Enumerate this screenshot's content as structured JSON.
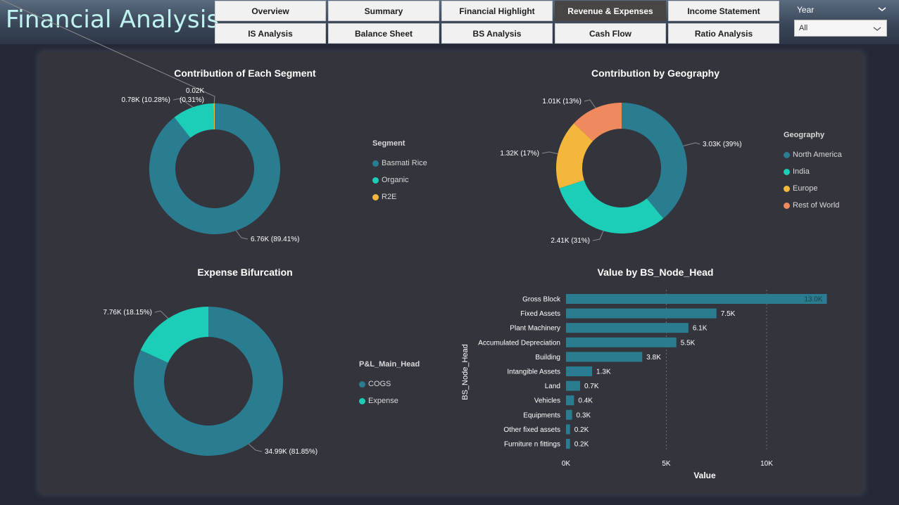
{
  "header": {
    "title": "Financial Analysis",
    "nav": [
      {
        "label": "Overview",
        "active": false
      },
      {
        "label": "Summary",
        "active": false
      },
      {
        "label": "Financial Highlight",
        "active": false
      },
      {
        "label": "Revenue & Expenses",
        "active": true
      },
      {
        "label": "Income Statement",
        "active": false
      },
      {
        "label": "IS Analysis",
        "active": false
      },
      {
        "label": "Balance Sheet",
        "active": false
      },
      {
        "label": "BS Analysis",
        "active": false
      },
      {
        "label": "Cash Flow",
        "active": false
      },
      {
        "label": "Ratio Analysis",
        "active": false
      }
    ],
    "year_filter": {
      "label": "Year",
      "value": "All",
      "icon": "chevron-down-icon"
    }
  },
  "colors": {
    "teal_dark": "#2a7d90",
    "teal_light": "#1ccdb7",
    "yellow": "#f5b73b",
    "orange": "#ee8a5e"
  },
  "chart_data": [
    {
      "type": "pie",
      "donut": true,
      "title": "Contribution of Each Segment",
      "legend_title": "Segment",
      "legend_position": "right",
      "slices": [
        {
          "name": "Basmati Rice",
          "value": 6.76,
          "label": "6.76K (89.41%)",
          "color": "#2a7d90"
        },
        {
          "name": "Organic",
          "value": 0.78,
          "label": "0.78K (10.28%)",
          "color": "#1ccdb7"
        },
        {
          "name": "R2E",
          "value": 0.02,
          "label": "0.02K (0.31%)",
          "color": "#f5b73b"
        }
      ]
    },
    {
      "type": "pie",
      "donut": true,
      "title": "Contribution by Geography",
      "legend_title": "Geography",
      "legend_position": "right",
      "slices": [
        {
          "name": "North America",
          "value": 3.03,
          "label": "3.03K (39%)",
          "color": "#2a7d90"
        },
        {
          "name": "India",
          "value": 2.41,
          "label": "2.41K (31%)",
          "color": "#1ccdb7"
        },
        {
          "name": "Europe",
          "value": 1.32,
          "label": "1.32K (17%)",
          "color": "#f5b73b"
        },
        {
          "name": "Rest of World",
          "value": 1.01,
          "label": "1.01K (13%)",
          "color": "#ee8a5e"
        }
      ]
    },
    {
      "type": "pie",
      "donut": true,
      "title": "Expense Bifurcation",
      "legend_title": "P&L_Main_Head",
      "legend_position": "right",
      "slices": [
        {
          "name": "COGS",
          "value": 34.99,
          "label": "34.99K (81.85%)",
          "color": "#2a7d90"
        },
        {
          "name": "Expense",
          "value": 7.76,
          "label": "7.76K (18.15%)",
          "color": "#1ccdb7"
        }
      ]
    },
    {
      "type": "bar",
      "orientation": "horizontal",
      "title": "Value by BS_Node_Head",
      "xlabel": "Value",
      "ylabel": "BS_Node_Head",
      "xlim": [
        0,
        13000
      ],
      "xticks": [
        {
          "value": 0,
          "label": "0K"
        },
        {
          "value": 5000,
          "label": "5K"
        },
        {
          "value": 10000,
          "label": "10K"
        }
      ],
      "grid": true,
      "color": "#2a7d90",
      "categories": [
        "Gross Block",
        "Fixed Assets",
        "Plant Machinery",
        "Accumulated Depreciation",
        "Building",
        "Intangible Assets",
        "Land",
        "Vehicles",
        "Equipments",
        "Other fixed assets",
        "Furniture n fittings"
      ],
      "values": [
        13000,
        7500,
        6100,
        5500,
        3800,
        1300,
        700,
        400,
        300,
        200,
        200
      ],
      "value_labels": [
        "13.0K",
        "7.5K",
        "6.1K",
        "5.5K",
        "3.8K",
        "1.3K",
        "0.7K",
        "0.4K",
        "0.3K",
        "0.2K",
        "0.2K"
      ]
    }
  ]
}
